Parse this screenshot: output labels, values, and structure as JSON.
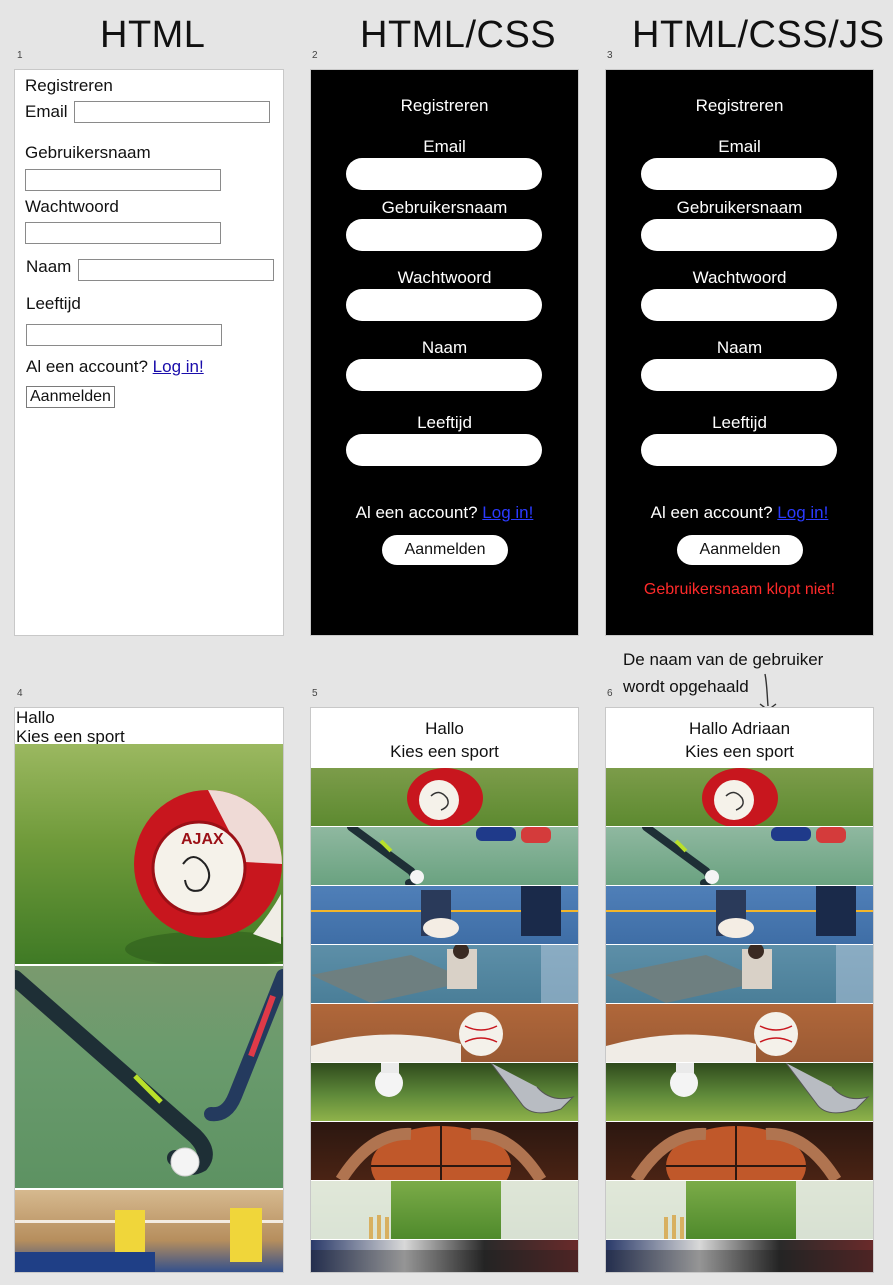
{
  "columns": [
    "HTML",
    "HTML/CSS",
    "HTML/CSS/JS"
  ],
  "artboard_numbers": [
    "1",
    "2",
    "3",
    "4",
    "5",
    "6"
  ],
  "register": {
    "title": "Registreren",
    "fields": [
      "Email",
      "Gebruikersnaam",
      "Wachtwoord",
      "Naam",
      "Leeftijd"
    ],
    "account_question": "Al een account?",
    "login_link": "Log in!",
    "submit": "Aanmelden"
  },
  "error_message": "Gebruikersnaam klopt niet!",
  "annotation": {
    "line1": "De naam van de gebruiker",
    "line2": "wordt opgehaald"
  },
  "sports_page": {
    "greeting_plain": "Hallo",
    "greeting_user": "Hallo Adriaan",
    "choose": "Kies een sport"
  },
  "sports": [
    {
      "icon": "football-icon"
    },
    {
      "icon": "hockey-icon"
    },
    {
      "icon": "volleyball-icon"
    },
    {
      "icon": "table-tennis-icon"
    },
    {
      "icon": "baseball-icon"
    },
    {
      "icon": "golf-icon"
    },
    {
      "icon": "basketball-icon"
    },
    {
      "icon": "cricket-icon"
    },
    {
      "icon": "tennis-icon"
    }
  ],
  "colors": {
    "background": "#e5e5e5",
    "dark_panel": "#000000",
    "link": "#2b3bff",
    "error": "#ff2a2a"
  }
}
